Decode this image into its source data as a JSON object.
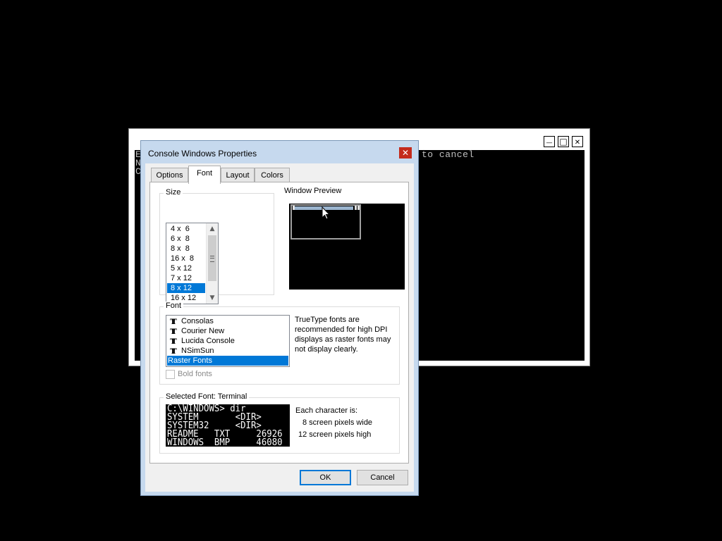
{
  "console": {
    "right_text": "to cancel",
    "left_chars": [
      "E",
      "N",
      "C"
    ],
    "btn_minimize": "—",
    "btn_maximize": "□",
    "btn_close": "✕"
  },
  "dialog": {
    "title": "Console Windows Properties",
    "close_glyph": "✕",
    "tabs": [
      "Options",
      "Font",
      "Layout",
      "Colors"
    ],
    "active_tab": "Font",
    "size_group_label": "Size",
    "sizes": [
      "4 x  6",
      "6 x  8",
      "8 x  8",
      "16 x  8",
      "5 x 12",
      "7 x 12",
      "8 x 12",
      "16 x 12"
    ],
    "selected_size": "8 x 12",
    "window_preview_label": "Window Preview",
    "font_group_label": "Font",
    "fonts": [
      {
        "name": "Consolas",
        "icon": "truetype-icon"
      },
      {
        "name": "Courier New",
        "icon": "truetype-icon"
      },
      {
        "name": "Lucida Console",
        "icon": "truetype-icon"
      },
      {
        "name": "NSimSun",
        "icon": "truetype-icon"
      },
      {
        "name": "Raster Fonts",
        "icon": ""
      }
    ],
    "selected_font": "Raster Fonts",
    "truetype_note": "TrueType fonts are recommended for high DPI displays as raster fonts may not display clearly.",
    "bold_fonts_label": "Bold fonts",
    "bold_fonts_checked": false,
    "selected_font_label": "Selected Font: Terminal",
    "sample_lines": [
      "C:\\WINDOWS> dir",
      "SYSTEM       <DIR>",
      "SYSTEM32     <DIR>",
      "README   TXT     26926",
      "WINDOWS  BMP     46080"
    ],
    "char_info_title": "Each character is:",
    "char_width": "8 screen pixels wide",
    "char_height": "12 screen pixels high",
    "ok_label": "OK",
    "cancel_label": "Cancel"
  },
  "colors": {
    "selection": "#0078d7",
    "title_bar": "#c6d9ee",
    "close_red": "#c42b1c"
  }
}
